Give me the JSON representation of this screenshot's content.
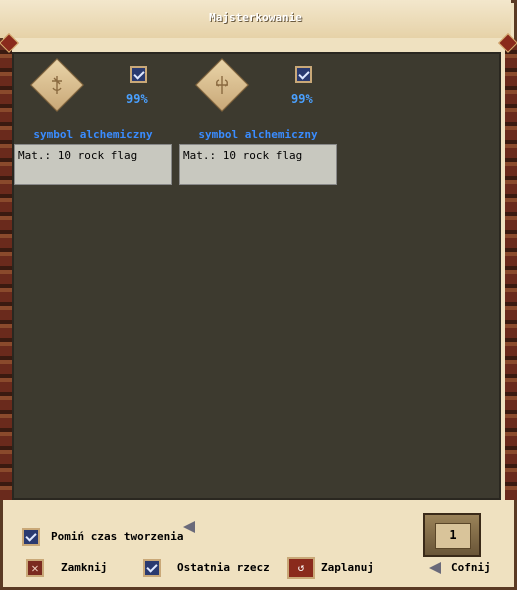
{
  "window": {
    "title": "Majsterkowanie"
  },
  "items": [
    {
      "name": "symbol alchemiczny",
      "success": "99%",
      "materials": "Mat.: 10 rock flag",
      "icon": "alchemy-symbol-icon-1",
      "checked": true
    },
    {
      "name": "symbol alchemiczny",
      "success": "99%",
      "materials": "Mat.: 10 rock flag",
      "icon": "alchemy-symbol-icon-2",
      "checked": true
    }
  ],
  "footer": {
    "skip_label": "Pomiń czas tworzenia",
    "close_label": "Zamknij",
    "last_label": "Ostatnia rzecz",
    "plan_label": "Zaplanuj",
    "back_label": "Cofnij",
    "count": "1"
  }
}
